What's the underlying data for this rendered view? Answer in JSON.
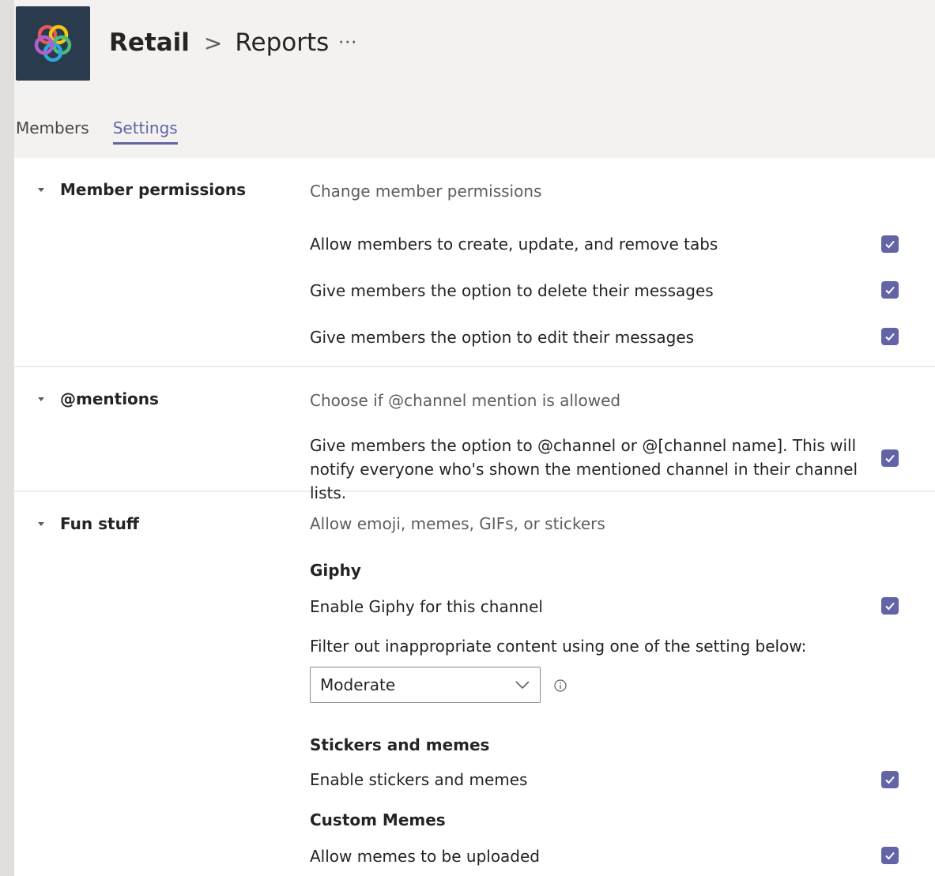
{
  "header": {
    "team": "Retail",
    "separator": ">",
    "channel": "Reports",
    "more": "···",
    "logo_icon": "colorful-knot-logo"
  },
  "tabs": [
    {
      "label": "Members",
      "active": false
    },
    {
      "label": "Settings",
      "active": true
    }
  ],
  "accent_color": "#6264a7",
  "sections": {
    "member_permissions": {
      "title": "Member permissions",
      "description": "Change member permissions",
      "items": [
        {
          "label": "Allow members to create, update, and remove tabs",
          "checked": true
        },
        {
          "label": "Give members the option to delete their messages",
          "checked": true
        },
        {
          "label": "Give members the option to edit their messages",
          "checked": true
        }
      ]
    },
    "mentions": {
      "title": "@mentions",
      "description": "Choose if @channel mention is allowed",
      "items": [
        {
          "label": "Give members the option to @channel or @[channel name]. This will notify everyone who's shown the mentioned channel in their channel lists.",
          "checked": true
        }
      ]
    },
    "fun_stuff": {
      "title": "Fun stuff",
      "description": "Allow emoji, memes, GIFs, or stickers",
      "giphy_heading": "Giphy",
      "giphy_enable": {
        "label": "Enable Giphy for this channel",
        "checked": true
      },
      "filter_label": "Filter out inappropriate content using one of the setting below:",
      "filter_value": "Moderate",
      "stickers_heading": "Stickers and memes",
      "stickers_enable": {
        "label": "Enable stickers and memes",
        "checked": true
      },
      "custom_heading": "Custom Memes",
      "custom_enable": {
        "label": "Allow memes to be uploaded",
        "checked": true
      }
    }
  }
}
